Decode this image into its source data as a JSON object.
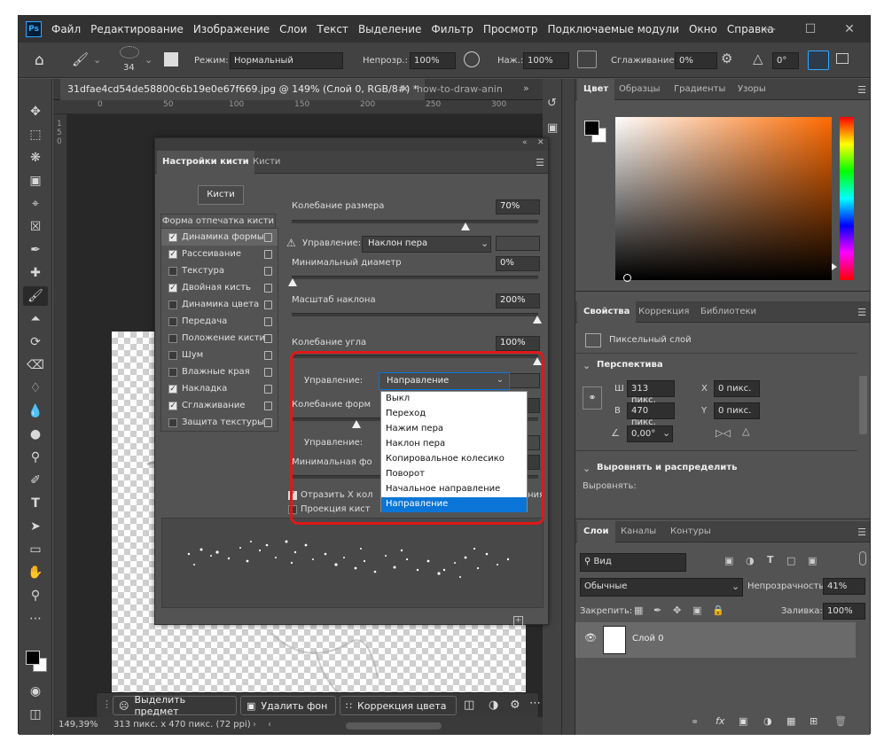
{
  "app": {
    "logo": "Ps"
  },
  "menu": [
    "Файл",
    "Редактирование",
    "Изображение",
    "Слои",
    "Текст",
    "Выделение",
    "Фильтр",
    "Просмотр",
    "Подключаемые модули",
    "Окно",
    "Справка"
  ],
  "options_bar": {
    "brush_size": "34",
    "mode_label": "Режим:",
    "mode_value": "Нормальный",
    "opacity_label": "Непрозр.:",
    "opacity_value": "100%",
    "flow_label": "Наж.:",
    "flow_value": "100%",
    "smoothing_label": "Сглаживание:",
    "smoothing_value": "0%",
    "angle_value": "0°"
  },
  "document": {
    "tab_active": "31dfae4cd54de58800c6b19e0e67f669.jpg @ 149% (Слой 0, RGB/8#) *",
    "tab_other": "how-to-draw-anin",
    "ruler_ticks": [
      "0",
      "50",
      "100",
      "150",
      "200",
      "250",
      "300"
    ],
    "vruler_ticks": [
      "1",
      "5",
      "0"
    ],
    "status_zoom": "149,39%",
    "status_info": "313 пикс. x 470 пикс. (72 ppi)"
  },
  "context_bar": {
    "select_subject": "Выделить предмет",
    "remove_bg": "Удалить фон",
    "color_correct": "Коррекция цвета"
  },
  "brush_panel": {
    "tab_active": "Настройки кисти",
    "tab_other": "Кисти",
    "brushes_button": "Кисти",
    "tip_shape": "Форма отпечатка кисти",
    "options": [
      {
        "label": "Динамика формы",
        "checked": true,
        "selected": true
      },
      {
        "label": "Рассеивание",
        "checked": true,
        "selected": false
      },
      {
        "label": "Текстура",
        "checked": false,
        "selected": false
      },
      {
        "label": "Двойная кисть",
        "checked": true,
        "selected": false
      },
      {
        "label": "Динамика цвета",
        "checked": false,
        "selected": false
      },
      {
        "label": "Передача",
        "checked": false,
        "selected": false
      },
      {
        "label": "Положение кисти",
        "checked": false,
        "selected": false
      },
      {
        "label": "Шум",
        "checked": false,
        "selected": false
      },
      {
        "label": "Влажные края",
        "checked": false,
        "selected": false
      },
      {
        "label": "Накладка",
        "checked": true,
        "selected": false
      },
      {
        "label": "Сглаживание",
        "checked": true,
        "selected": false
      },
      {
        "label": "Защита текстуры",
        "checked": false,
        "selected": false
      }
    ],
    "size_jitter_label": "Колебание размера",
    "size_jitter_value": "70%",
    "size_jitter_level": 0.7,
    "control_label": "Управление:",
    "control1_value": "Наклон пера",
    "min_diameter_label": "Минимальный диаметр",
    "min_diameter_value": "0%",
    "tilt_scale_label": "Масштаб наклона",
    "tilt_scale_value": "200%",
    "angle_jitter_label": "Колебание угла",
    "angle_jitter_value": "100%",
    "control2_value": "Направление",
    "roundness_jitter_label": "Колебание форм",
    "roundness_value_partial": "%",
    "control3_label": "Управление:",
    "min_round_label": "Минимальная фо",
    "min_round_value_partial": "%",
    "flip_x_label": "Отразить Х кол",
    "flip_x_suffix": "ния",
    "projection_label": "Проекция кист",
    "dropdown_options": [
      "Выкл",
      "Переход",
      "Нажим пера",
      "Наклон пера",
      "Копировальное колесико",
      "Поворот",
      "Начальное направление",
      "Направление"
    ],
    "dropdown_selected": "Направление"
  },
  "color_panel": {
    "tabs": [
      "Цвет",
      "Образцы",
      "Градиенты",
      "Узоры"
    ],
    "foreground": "#000000",
    "background": "#ffffff",
    "hue": "#ff6a00"
  },
  "properties_panel": {
    "tabs": [
      "Свойства",
      "Коррекция",
      "Библиотеки"
    ],
    "layer_type": "Пиксельный слой",
    "perspective": "Перспектива",
    "w_label": "Ш",
    "w_value": "313 пикс.",
    "h_label": "В",
    "h_value": "470 пикс.",
    "x_label": "X",
    "x_value": "0 пикс.",
    "y_label": "Y",
    "y_value": "0 пикс.",
    "angle_value": "0,00°",
    "align_section": "Выровнять и распределить",
    "align_label": "Выровнять:"
  },
  "layers_panel": {
    "tabs": [
      "Слои",
      "Каналы",
      "Контуры"
    ],
    "filter_label": "Вид",
    "blend_mode": "Обычные",
    "opacity_label": "Непрозрачность:",
    "opacity_value": "41%",
    "lock_label": "Закрепить:",
    "fill_label": "Заливка:",
    "fill_value": "100%",
    "layer_name": "Слой 0"
  }
}
